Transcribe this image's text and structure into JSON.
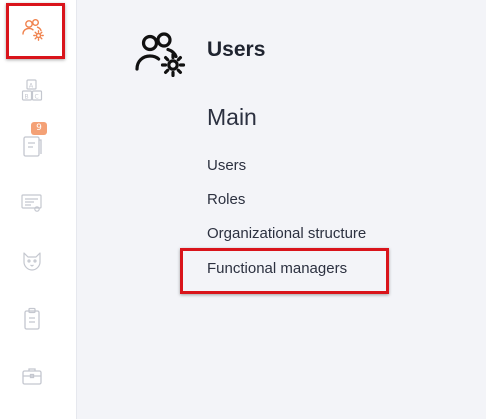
{
  "sidebar": {
    "items": [
      {
        "icon": "users-gear-icon",
        "active": true
      },
      {
        "icon": "abc-blocks-icon"
      },
      {
        "icon": "notebook-icon",
        "badge": "9"
      },
      {
        "icon": "monitor-icon"
      },
      {
        "icon": "cat-head-icon"
      },
      {
        "icon": "clipboard-icon"
      },
      {
        "icon": "briefcase-icon"
      }
    ]
  },
  "header": {
    "icon": "users-gear-icon",
    "title": "Users"
  },
  "section": {
    "title": "Main",
    "links": [
      {
        "label": "Users"
      },
      {
        "label": "Roles"
      },
      {
        "label": "Organizational structure"
      },
      {
        "label": "Functional managers",
        "highlighted": true
      }
    ]
  },
  "colors": {
    "accent": "#f0824d",
    "highlight_border": "#d9141b",
    "badge": "#f4a176",
    "sidebar_icon": "#c4c7cf",
    "page_background": "#f3f4f8"
  }
}
